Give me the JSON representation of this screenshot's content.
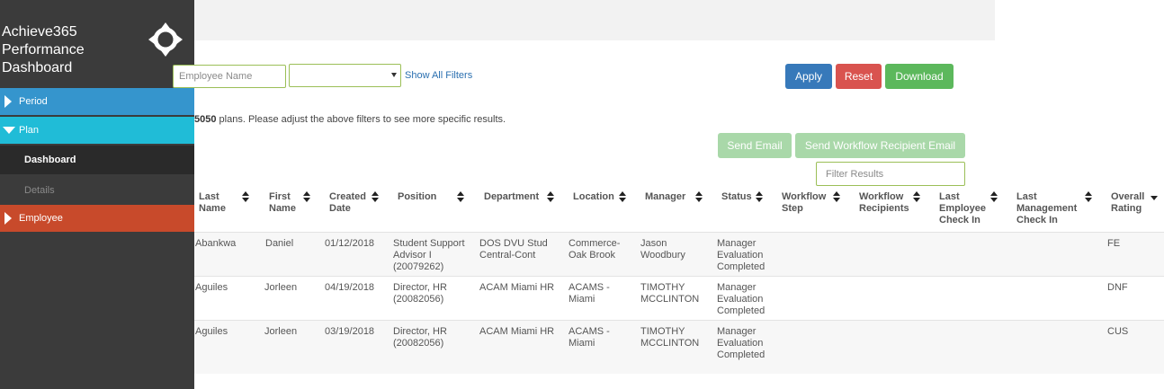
{
  "sidebar": {
    "title_line1": "Achieve365",
    "title_line2": "Performance",
    "title_line3": "Dashboard",
    "logo_icon": "crosshair-logo-icon",
    "items": [
      {
        "label": "Period",
        "color": "#3595cd"
      },
      {
        "label": "Plan",
        "color": "#20bcd7"
      },
      {
        "label": "Dashboard"
      },
      {
        "label": "Details"
      },
      {
        "label": "Employee",
        "color": "#c84a2b"
      }
    ]
  },
  "filters": {
    "employee_placeholder": "Employee Name",
    "select_value": "",
    "show_all": "Show All Filters"
  },
  "buttons": {
    "apply": "Apply",
    "reset": "Reset",
    "download": "Download",
    "send_email": "Send Email",
    "send_workflow_email": "Send Workflow Recipient Email"
  },
  "summary": {
    "count": "5050",
    "text": " plans. Please adjust the above filters to see more specific results."
  },
  "filter_results_placeholder": "Filter Results",
  "table": {
    "headers": [
      {
        "l1": "Last",
        "l2": "Name"
      },
      {
        "l1": "First",
        "l2": "Name"
      },
      {
        "l1": "Created",
        "l2": "Date"
      },
      {
        "l1": "Position",
        "l2": ""
      },
      {
        "l1": "Department",
        "l2": ""
      },
      {
        "l1": "Location",
        "l2": ""
      },
      {
        "l1": "Manager",
        "l2": ""
      },
      {
        "l1": "Status",
        "l2": ""
      },
      {
        "l1": "Workflow",
        "l2": "Step"
      },
      {
        "l1": "Workflow",
        "l2": "Recipients"
      },
      {
        "l1": "Last",
        "l2": "Employee",
        "l3": "Check In"
      },
      {
        "l1": "Last",
        "l2": "Management",
        "l3": "Check In"
      },
      {
        "l1": "Overall",
        "l2": "Rating"
      }
    ],
    "rows": [
      {
        "last": "Abankwa",
        "first": "Daniel",
        "created": "01/12/2018",
        "position": [
          "Student Support",
          "Advisor I",
          "(20079262)"
        ],
        "department": [
          "DOS DVU Stud",
          "Central-Cont"
        ],
        "location": [
          "Commerce-",
          "Oak Brook"
        ],
        "manager": [
          "Jason",
          "Woodbury"
        ],
        "status": [
          "Manager",
          "Evaluation",
          "Completed"
        ],
        "rating": "FE"
      },
      {
        "last": "Aguiles",
        "first": "Jorleen",
        "created": "04/19/2018",
        "position": [
          "Director, HR",
          "(20082056)"
        ],
        "department": [
          "ACAM Miami HR"
        ],
        "location": [
          "ACAMS -",
          "Miami"
        ],
        "manager": [
          "TIMOTHY",
          "MCCLINTON"
        ],
        "status": [
          "Manager",
          "Evaluation",
          "Completed"
        ],
        "rating": "DNF"
      },
      {
        "last": "Aguiles",
        "first": "Jorleen",
        "created": "03/19/2018",
        "position": [
          "Director, HR",
          "(20082056)"
        ],
        "department": [
          "ACAM Miami HR"
        ],
        "location": [
          "ACAMS -",
          "Miami"
        ],
        "manager": [
          "TIMOTHY",
          "MCCLINTON"
        ],
        "status": [
          "Manager",
          "Evaluation",
          "Completed"
        ],
        "rating": "CUS"
      }
    ]
  }
}
